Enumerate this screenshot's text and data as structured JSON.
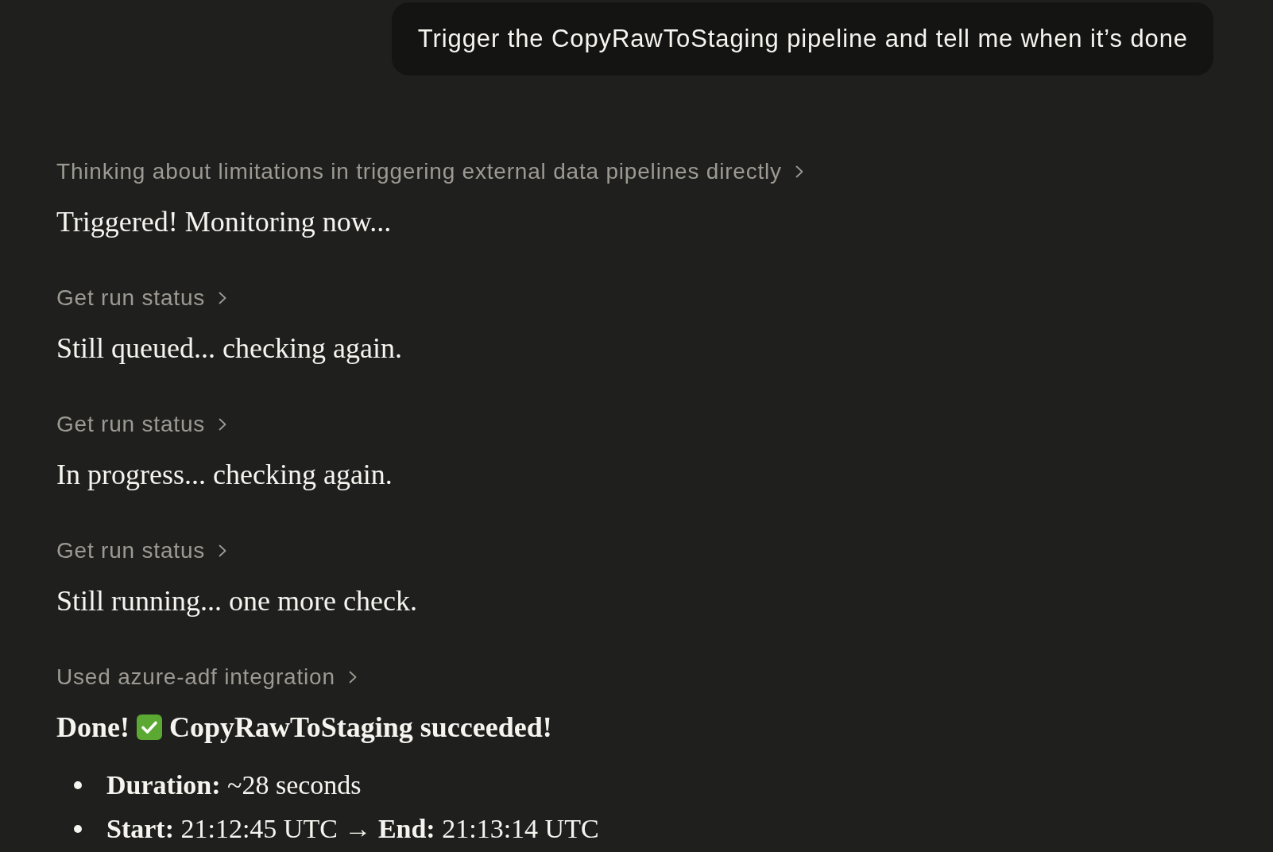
{
  "user_message": {
    "text": "Trigger the CopyRawToStaging pipeline and tell me when it’s done"
  },
  "response": [
    {
      "kind": "step",
      "text": "Thinking about limitations in triggering external data pipelines directly",
      "expanded": false
    },
    {
      "kind": "paragraph",
      "text": "Triggered! Monitoring now..."
    },
    {
      "kind": "step",
      "text": "Get run status",
      "expanded": false
    },
    {
      "kind": "paragraph",
      "text": "Still queued... checking again."
    },
    {
      "kind": "step",
      "text": "Get run status",
      "expanded": false
    },
    {
      "kind": "paragraph",
      "text": "In progress... checking again."
    },
    {
      "kind": "step",
      "text": "Get run status",
      "expanded": false
    },
    {
      "kind": "paragraph",
      "text": "Still running... one more check."
    },
    {
      "kind": "step",
      "text": "Used azure-adf integration",
      "expanded": false
    },
    {
      "kind": "status",
      "lead": "Done!",
      "text": "CopyRawToStaging succeeded!"
    },
    {
      "kind": "bullets",
      "items": [
        "**Duration:** ~28 seconds",
        "**Start:** 21:12:45 UTC → **End:** 21:13:14 UTC"
      ]
    }
  ]
}
